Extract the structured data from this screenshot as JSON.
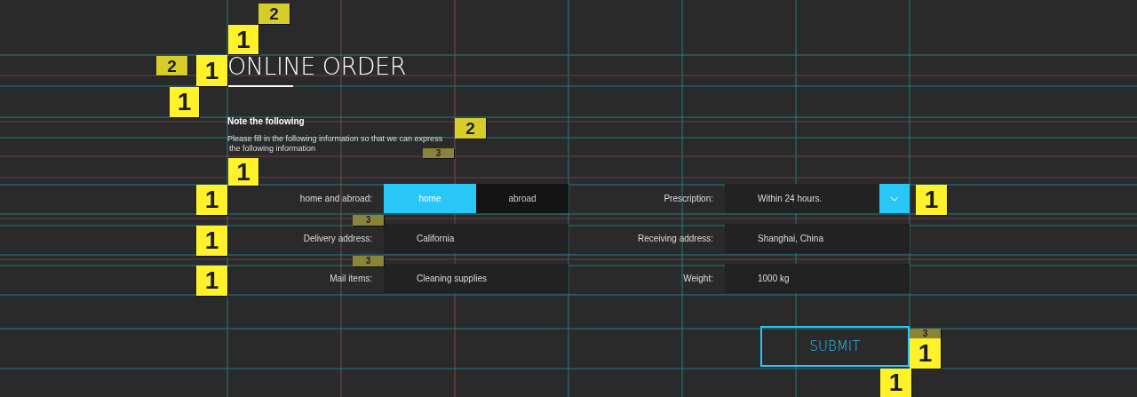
{
  "title": "ONLINE ORDER",
  "note": {
    "heading": "Note the following",
    "lines": [
      "Please fill in the following information so that we can express",
      "the following information"
    ]
  },
  "fields": [
    {
      "label": "home and abroad:",
      "kind": "toggle",
      "options": [
        {
          "label": "home",
          "selected": true
        },
        {
          "label": "abroad",
          "selected": false
        }
      ]
    },
    {
      "label": "Prescription:",
      "kind": "select",
      "value": "Within 24 hours."
    },
    {
      "label": "Delivery address:",
      "kind": "text",
      "value": "California"
    },
    {
      "label": "Receiving address:",
      "kind": "text",
      "value": "Shanghai, China"
    },
    {
      "label": "Mail items:",
      "kind": "text",
      "value": "Cleaning supplies"
    },
    {
      "label": "Weight:",
      "kind": "text",
      "value": "1000 kg"
    }
  ],
  "submit_button": "SUBMIT",
  "markers": [
    {
      "label": "2",
      "kind": "secondary"
    },
    {
      "label": "1",
      "kind": "primary"
    },
    {
      "label": "2",
      "kind": "secondary"
    },
    {
      "label": "1",
      "kind": "primary"
    },
    {
      "label": "1",
      "kind": "primary"
    },
    {
      "label": "2",
      "kind": "secondary"
    },
    {
      "label": "3",
      "kind": "tertiary"
    },
    {
      "label": "1",
      "kind": "primary"
    },
    {
      "label": "1",
      "kind": "primary"
    },
    {
      "label": "1",
      "kind": "primary"
    },
    {
      "label": "3",
      "kind": "tertiary"
    },
    {
      "label": "1",
      "kind": "primary"
    },
    {
      "label": "3",
      "kind": "tertiary"
    },
    {
      "label": "1",
      "kind": "primary"
    },
    {
      "label": "3",
      "kind": "tertiary"
    },
    {
      "label": "1",
      "kind": "primary"
    },
    {
      "label": "1",
      "kind": "primary"
    }
  ]
}
